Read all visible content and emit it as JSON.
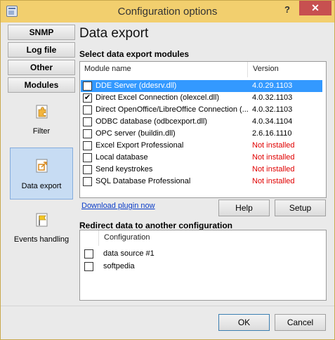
{
  "window": {
    "title": "Configuration options",
    "help_glyph": "?",
    "close_glyph": "✕"
  },
  "nav": {
    "buttons": [
      "SNMP",
      "Log file",
      "Other",
      "Modules"
    ],
    "tiles": [
      {
        "label": "Filter",
        "icon": "puzzle-icon"
      },
      {
        "label": "Data export",
        "icon": "export-icon",
        "selected": true
      },
      {
        "label": "Events handling",
        "icon": "flag-icon"
      }
    ]
  },
  "page": {
    "title": "Data export",
    "modules_section": "Select data export modules",
    "columns": {
      "name": "Module name",
      "version": "Version"
    },
    "modules": [
      {
        "name": "DDE Server (ddesrv.dll)",
        "version": "4.0.29.1103",
        "checked": false,
        "selected": true,
        "installed": true
      },
      {
        "name": "Direct Excel Connection (olexcel.dll)",
        "version": "4.0.32.1103",
        "checked": true,
        "installed": true
      },
      {
        "name": "Direct OpenOffice/LibreOffice Connection (...",
        "version": "4.0.32.1103",
        "checked": false,
        "installed": true
      },
      {
        "name": "ODBC database (odbcexport.dll)",
        "version": "4.0.34.1104",
        "checked": false,
        "installed": true
      },
      {
        "name": "OPC server (buildin.dll)",
        "version": "2.6.16.1110",
        "checked": false,
        "installed": true
      },
      {
        "name": "Excel Export Professional",
        "version": "Not installed",
        "checked": false,
        "installed": false
      },
      {
        "name": "Local database",
        "version": "Not installed",
        "checked": false,
        "installed": false
      },
      {
        "name": "Send keystrokes",
        "version": "Not installed",
        "checked": false,
        "installed": false
      },
      {
        "name": "SQL Database Professional",
        "version": "Not installed",
        "checked": false,
        "installed": false
      }
    ],
    "download_link": "Download plugin now",
    "help_button": "Help",
    "setup_button": "Setup",
    "redirect_section": "Redirect data to another configuration",
    "config_column": "Configuration",
    "configurations": [
      {
        "name": "data source #1",
        "checked": false
      },
      {
        "name": "softpedia",
        "checked": false
      }
    ]
  },
  "footer": {
    "ok": "OK",
    "cancel": "Cancel"
  },
  "colors": {
    "titlebar": "#f2cf6e",
    "selection": "#3399ff",
    "not_installed": "#e00000",
    "link": "#0a3cc8"
  }
}
